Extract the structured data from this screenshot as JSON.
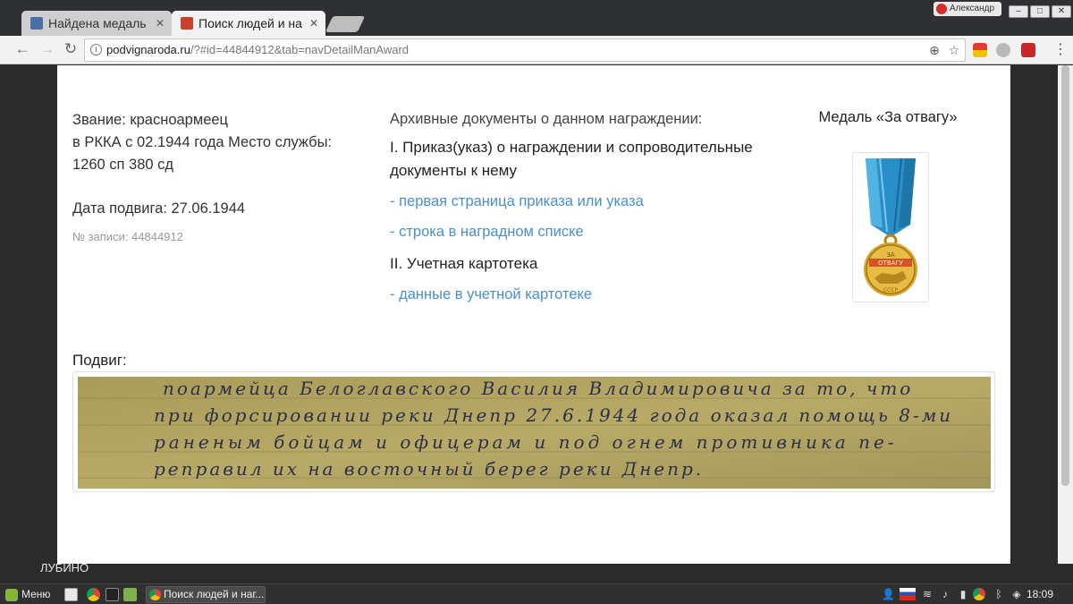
{
  "browser": {
    "tabs": [
      {
        "label": "Найдена медаль",
        "active": false
      },
      {
        "label": "Поиск людей и на",
        "active": true
      }
    ],
    "profile_name": "Александр",
    "url": {
      "host": "podvignaroda.ru",
      "path": "/?#id=44844912&tab=navDetailManAward"
    },
    "window_buttons": [
      "minimize",
      "maximize",
      "close"
    ]
  },
  "page": {
    "rank_line": "Звание: красноармеец",
    "service_line_1": "в РККА с 02.1944 года Место службы:",
    "service_line_2": "1260 сп 380 сд",
    "feat_date": "Дата подвига: 27.06.1944",
    "record_no": "№ записи: 44844912",
    "archive_header": "Архивные документы о данном награждении:",
    "section1": "I. Приказ(указ) о награждении и сопроводительные документы к нему",
    "link_first_page": "- первая страница приказа или указа",
    "link_award_list_row": "- строка в наградном списке",
    "section2": "II. Учетная картотека",
    "link_card_index": "- данные в учетной картотеке",
    "medal_title": "Медаль «За отвагу»",
    "medal_inscription_1": "ЗА",
    "medal_inscription_2": "ОТВАГУ",
    "medal_inscription_3": "СССР",
    "feat_label": "Подвиг:",
    "feat_handwriting": [
      "поармейца Белоглавского Василия Владимировича за то, что",
      "при форсировании реки Днепр 27.6.1944 года оказал помощь 8-ми",
      "раненым бойцам и офицерам и под огнем противника пе-",
      "реправил их на восточный берег реки Днепр."
    ],
    "bottom_fragment": "ЛУБИНО"
  },
  "taskbar": {
    "menu_label": "Меню",
    "task_label": "Поиск людей и наг...",
    "clock": "18:09"
  },
  "colors": {
    "link": "#4a90c8",
    "medal_ribbon": "#2a8fc9",
    "medal_gold": "#d9a42a",
    "scan_paper": "#b3a662"
  },
  "icons": [
    "info-icon",
    "back-icon",
    "forward-icon",
    "reload-icon",
    "zoom-icon",
    "star-icon",
    "menu-dots-icon"
  ]
}
